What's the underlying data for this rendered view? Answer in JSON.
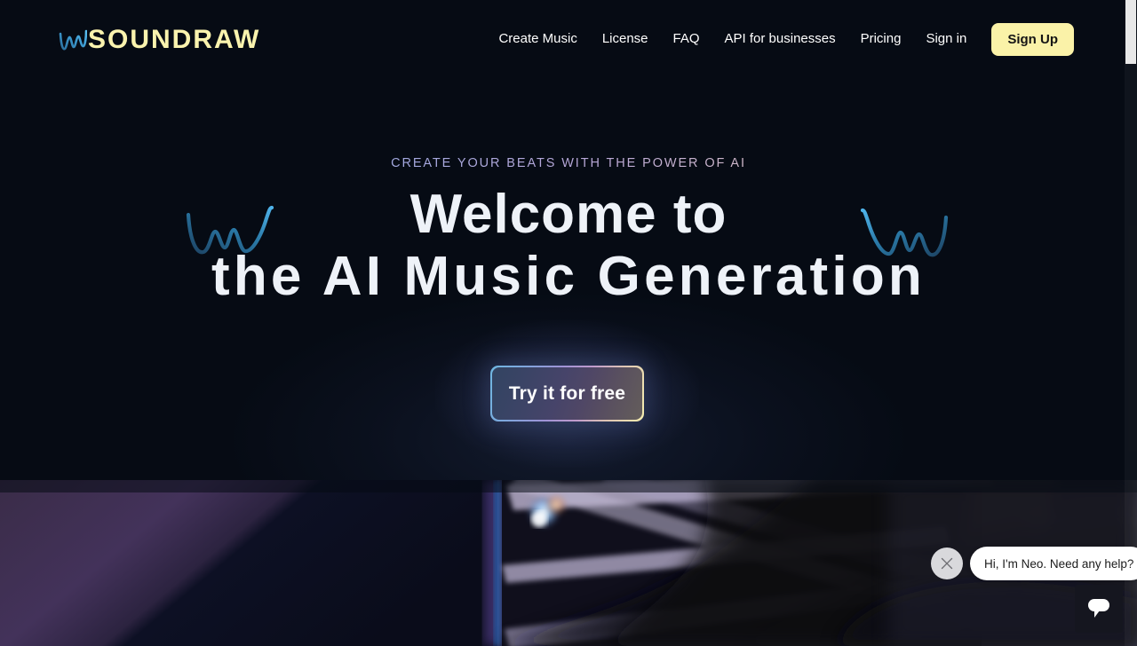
{
  "brand": {
    "logo_text": "SOUNDRAW",
    "logo_mark": "waveform-icon",
    "logo_color": "#faf3ae",
    "wave_color": "#4aa8e0"
  },
  "nav": {
    "items": [
      {
        "label": "Create Music",
        "name": "create-music"
      },
      {
        "label": "License",
        "name": "license"
      },
      {
        "label": "FAQ",
        "name": "faq"
      },
      {
        "label": "API for businesses",
        "name": "api-for-businesses"
      },
      {
        "label": "Pricing",
        "name": "pricing"
      },
      {
        "label": "Sign in",
        "name": "sign-in"
      }
    ],
    "signup_label": "Sign Up",
    "signup_bg": "#faf2a8",
    "signup_text_color": "#141414"
  },
  "hero": {
    "tagline": "CREATE YOUR BEATS WITH THE POWER OF AI",
    "headline_line1": "Welcome to",
    "headline_line2": "the AI Music Generation",
    "cta_label": "Try it for free",
    "background_color": "#060b14",
    "headline_color": "#eef2f8",
    "tagline_gradient_from": "#8ec7ea",
    "tagline_gradient_to": "#f8f2c0"
  },
  "media": {
    "description": "blurred dark photo of purple room with crossing light beams and a silhouette"
  },
  "chat": {
    "close_icon": "close-icon",
    "message": "Hi, I'm Neo. Need any help?",
    "launcher_icon": "chat-bubble-icon",
    "launcher_bg": "#15161f"
  }
}
